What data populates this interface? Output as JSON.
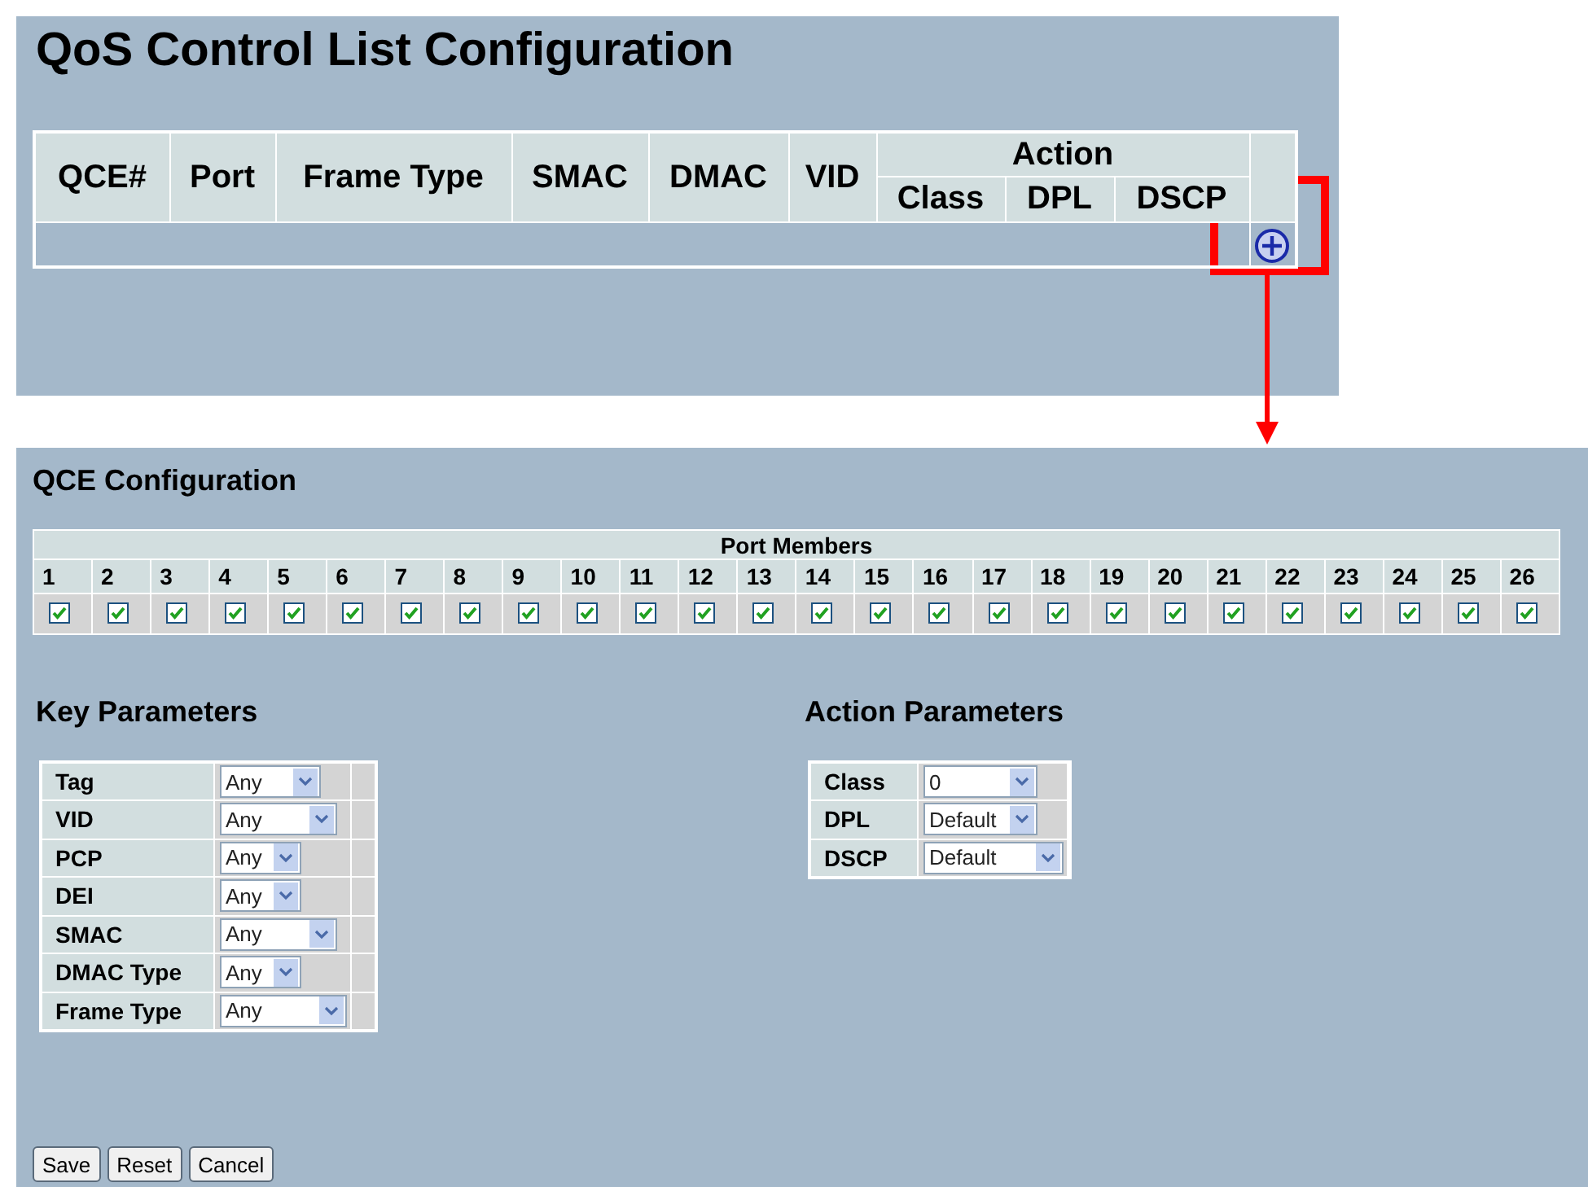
{
  "overview": {
    "title": "QoS Control List Configuration",
    "columns": [
      "QCE#",
      "Port",
      "Frame Type",
      "SMAC",
      "DMAC",
      "VID"
    ],
    "action_group": {
      "label": "Action",
      "columns": [
        "Class",
        "DPL",
        "DSCP"
      ]
    }
  },
  "qce_configuration": {
    "title": "QCE Configuration",
    "port_members": {
      "label": "Port Members",
      "ports": [
        {
          "label": "1",
          "checked": true
        },
        {
          "label": "2",
          "checked": true
        },
        {
          "label": "3",
          "checked": true
        },
        {
          "label": "4",
          "checked": true
        },
        {
          "label": "5",
          "checked": true
        },
        {
          "label": "6",
          "checked": true
        },
        {
          "label": "7",
          "checked": true
        },
        {
          "label": "8",
          "checked": true
        },
        {
          "label": "9",
          "checked": true
        },
        {
          "label": "10",
          "checked": true
        },
        {
          "label": "11",
          "checked": true
        },
        {
          "label": "12",
          "checked": true
        },
        {
          "label": "13",
          "checked": true
        },
        {
          "label": "14",
          "checked": true
        },
        {
          "label": "15",
          "checked": true
        },
        {
          "label": "16",
          "checked": true
        },
        {
          "label": "17",
          "checked": true
        },
        {
          "label": "18",
          "checked": true
        },
        {
          "label": "19",
          "checked": true
        },
        {
          "label": "20",
          "checked": true
        },
        {
          "label": "21",
          "checked": true
        },
        {
          "label": "22",
          "checked": true
        },
        {
          "label": "23",
          "checked": true
        },
        {
          "label": "24",
          "checked": true
        },
        {
          "label": "25",
          "checked": true
        },
        {
          "label": "26",
          "checked": true
        }
      ]
    },
    "key_parameters": {
      "title": "Key Parameters",
      "rows": [
        {
          "label": "Tag",
          "value": "Any"
        },
        {
          "label": "VID",
          "value": "Any"
        },
        {
          "label": "PCP",
          "value": "Any"
        },
        {
          "label": "DEI",
          "value": "Any"
        },
        {
          "label": "SMAC",
          "value": "Any"
        },
        {
          "label": "DMAC Type",
          "value": "Any"
        },
        {
          "label": "Frame Type",
          "value": "Any"
        }
      ]
    },
    "action_parameters": {
      "title": "Action Parameters",
      "rows": [
        {
          "label": "Class",
          "value": "0"
        },
        {
          "label": "DPL",
          "value": "Default"
        },
        {
          "label": "DSCP",
          "value": "Default"
        }
      ]
    },
    "buttons": [
      "Save",
      "Reset",
      "Cancel"
    ]
  }
}
